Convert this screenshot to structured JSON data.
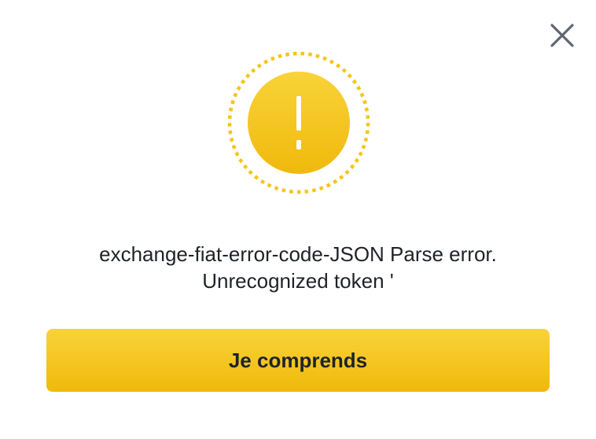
{
  "dialog": {
    "close_icon": "close-icon",
    "warning_icon": "exclamation-circle-icon",
    "message_line1": "exchange-fiat-error-code-JSON Parse error.",
    "message_line2": "Unrecognized token '",
    "confirm_label": "Je comprends"
  },
  "colors": {
    "accent": "#F0B90B",
    "accent_light": "#F8D33A",
    "text": "#1E2329",
    "close_icon": "#5E6673",
    "background": "#FFFFFF"
  }
}
